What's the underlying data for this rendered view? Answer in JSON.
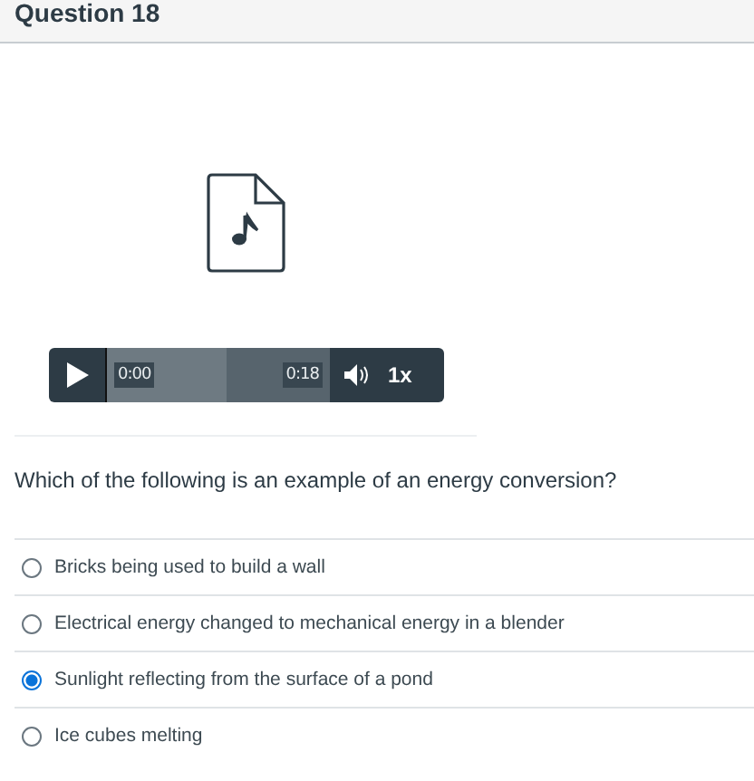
{
  "header": {
    "title": "Question 18"
  },
  "player": {
    "current_time": "0:00",
    "duration": "0:18",
    "speed": "1x",
    "buffer": {
      "level": 0.54
    }
  },
  "question": "Which of the following is an example of an energy conversion?",
  "options": [
    {
      "label": "Bricks being used to build a wall",
      "selected": false
    },
    {
      "label": "Electrical energy changed to mechanical energy in a blender",
      "selected": false
    },
    {
      "label": "Sunlight reflecting from the surface of a pond",
      "selected": true
    },
    {
      "label": "Ice cubes melting",
      "selected": false
    }
  ]
}
